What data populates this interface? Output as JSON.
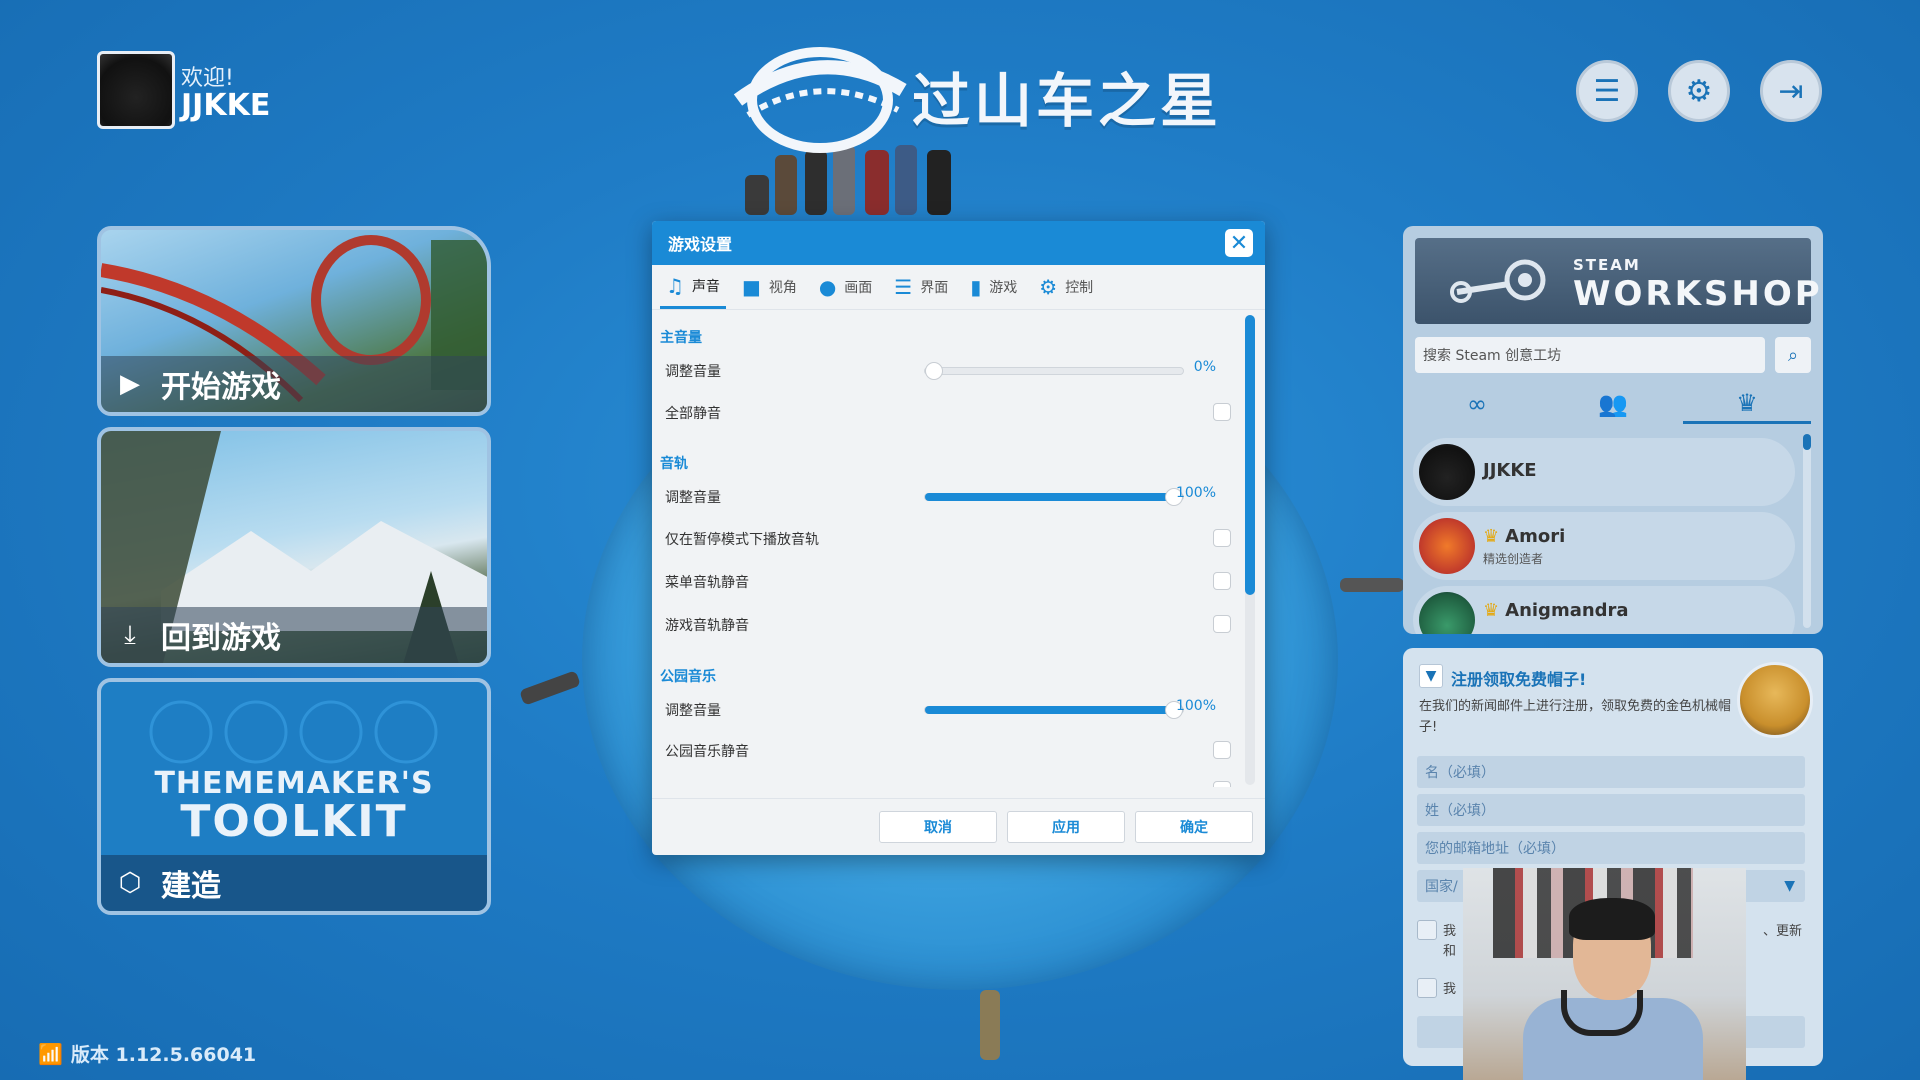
{
  "user": {
    "welcome": "欢迎!",
    "name": "JJKKE"
  },
  "logo": {
    "title": "过山车之星"
  },
  "top_buttons": [
    {
      "icon": "list-icon"
    },
    {
      "icon": "gear-icon"
    },
    {
      "icon": "exit-icon"
    }
  ],
  "cards": [
    {
      "label": "开始游戏",
      "icon": "play-icon"
    },
    {
      "label": "回到游戏",
      "icon": "download-icon"
    },
    {
      "label": "建造",
      "icon": "cube-icon",
      "banner_line1": "THEMEMAKER'S",
      "banner_line2": "TOOLKIT"
    }
  ],
  "version": "版本 1.12.5.66041",
  "dialog": {
    "title": "游戏设置",
    "tabs": [
      {
        "label": "声音",
        "icon": "music-icon",
        "active": true
      },
      {
        "label": "视角",
        "icon": "camera-icon"
      },
      {
        "label": "画面",
        "icon": "palette-icon"
      },
      {
        "label": "界面",
        "icon": "list-icon"
      },
      {
        "label": "游戏",
        "icon": "bar-chart-icon"
      },
      {
        "label": "控制",
        "icon": "gear-icon"
      }
    ],
    "sections": {
      "master": {
        "title": "主音量",
        "volume_label": "调整音量",
        "volume_value": 0,
        "volume_text": "0%",
        "mute_label": "全部静音"
      },
      "music": {
        "title": "音轨",
        "volume_label": "调整音量",
        "volume_value": 100,
        "volume_text": "100%",
        "pause_only_label": "仅在暂停模式下播放音轨",
        "menu_mute_label": "菜单音轨静音",
        "game_mute_label": "游戏音轨静音"
      },
      "park": {
        "title": "公园音乐",
        "volume_label": "调整音量",
        "volume_value": 100,
        "volume_text": "100%",
        "mute_label": "公园音乐静音"
      }
    },
    "buttons": {
      "cancel": "取消",
      "apply": "应用",
      "ok": "确定"
    }
  },
  "workshop": {
    "steam_label": "STEAM",
    "title": "WORKSHOP",
    "search_placeholder": "搜索 Steam 创意工坊",
    "tabs": [
      {
        "icon": "infinity-icon"
      },
      {
        "icon": "group-icon"
      },
      {
        "icon": "crown-icon",
        "active": true
      }
    ],
    "creators": [
      {
        "name": "JJKKE",
        "sub": ""
      },
      {
        "name": "Amori",
        "sub": "精选创造者"
      },
      {
        "name": "Anigmandra",
        "sub": ""
      }
    ]
  },
  "newsletter": {
    "title": "注册领取免费帽子!",
    "description": "在我们的新闻邮件上进行注册，领取免费的金色机械帽子!",
    "first_name": "名（必填）",
    "last_name": "姓（必填）",
    "email": "您的邮箱地址（必填）",
    "country": "国家/",
    "check1_a": "我",
    "check1_b": "和",
    "check1_c": "、更新",
    "check2": "我"
  },
  "colors": {
    "accent": "#1a8ad6",
    "background": "#1f7cc6"
  }
}
